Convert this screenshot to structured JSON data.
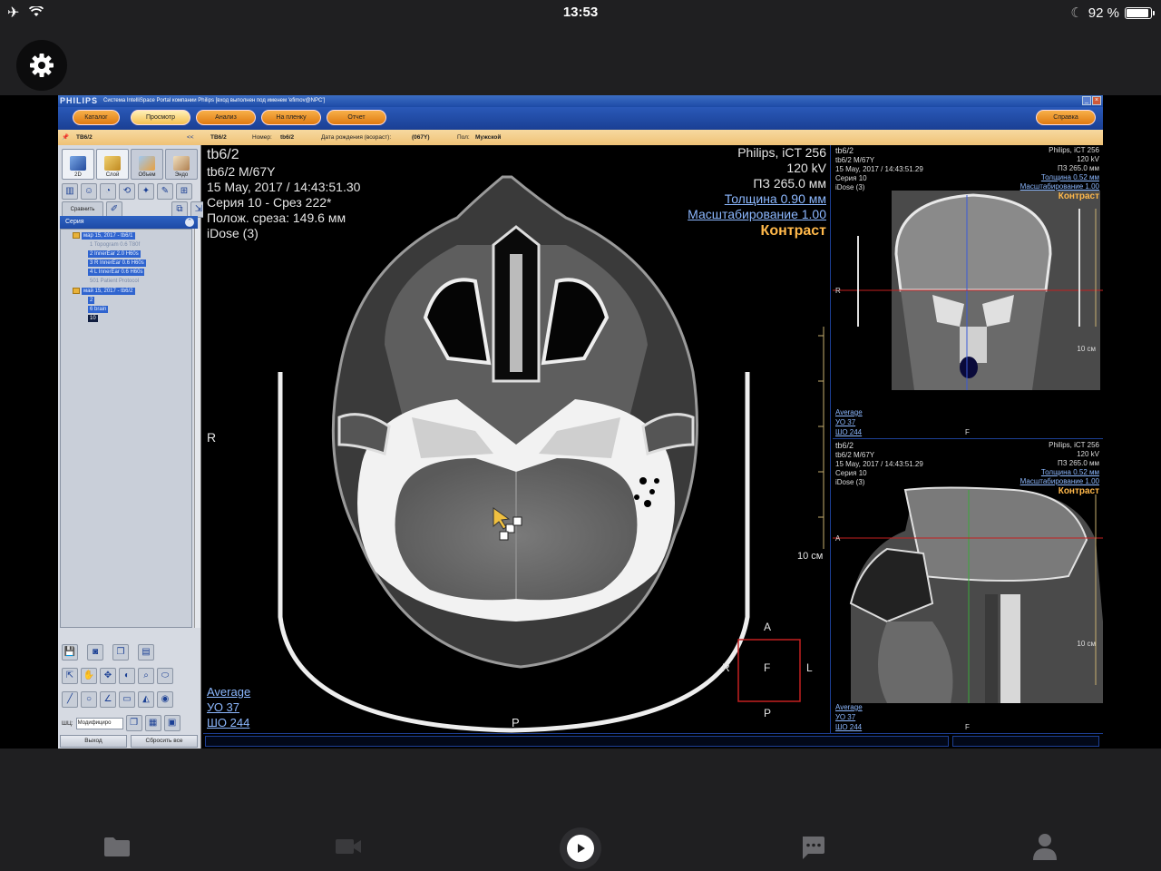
{
  "status_bar": {
    "time": "13:53",
    "battery": "92 %",
    "icons": [
      "airplane-icon",
      "wifi-icon",
      "moon-icon",
      "battery-icon"
    ]
  },
  "app": {
    "title_logo": "PHILIPS",
    "title_text": "Система IntelliSpace Portal компании Philips [вход выполнен под именем 'efimov@NPC']",
    "menu": [
      "Каталог",
      "Просмотр",
      "Анализ",
      "На пленку",
      "Отчет"
    ],
    "help_label": "Справка",
    "patient_bar": {
      "tab": "ТВ6/2",
      "name": "ТВ6/2",
      "number_label": "Номер:",
      "number": "tb6/2",
      "dob_label": "Дата рождения (возраст):",
      "dob": "(067Y)",
      "sex_label": "Пол:",
      "sex": "Мужской"
    }
  },
  "left_panel": {
    "view_modes": [
      {
        "label": "2D"
      },
      {
        "label": "Слой"
      },
      {
        "label": "Объем"
      },
      {
        "label": "Эндо"
      }
    ],
    "compare_label": "Сравнить",
    "collapse_label": "<<",
    "series_title": "Серия",
    "tree": [
      {
        "text": "мар 15, 2017 - tb6/1",
        "kind": "study"
      },
      {
        "text": "1  Topogram  0.6  T80f",
        "kind": "dim"
      },
      {
        "text": "2  InnerEar  2.0  H60s",
        "kind": "sel"
      },
      {
        "text": "3  R  InnerEar  0.6  H60s",
        "kind": "sel"
      },
      {
        "text": "4  L  InnerEar  0.6  H60s",
        "kind": "sel"
      },
      {
        "text": "501  Patient Protocol",
        "kind": "dim"
      },
      {
        "text": "май 15, 2017 - tb6/2",
        "kind": "study"
      },
      {
        "text": "2",
        "kind": "sel"
      },
      {
        "text": "6  brain",
        "kind": "sel"
      },
      {
        "text": "10",
        "kind": "dark"
      }
    ],
    "wl_label": "ШЦ:",
    "wl_value": "Модифициро",
    "exit_label": "Выход",
    "reset_label": "Сбросить все"
  },
  "main_view": {
    "top_left": [
      "tb6/2",
      "tb6/2 M/67Y",
      "15 May, 2017 / 14:43:51.30",
      "Серия 10 - Срез 222*",
      "Полож. среза: 149.6 мм",
      "iDose (3)"
    ],
    "top_right": [
      "Philips, iCT 256",
      "120 kV",
      "ПЗ 265.0 мм"
    ],
    "thickness": "Толщина 0.90 мм",
    "scaling": "Масштабирование 1.00",
    "contrast": "Контраст",
    "scale_label": "10 см",
    "orient_r": "R",
    "orient_p": "P",
    "bottom_left": [
      "Average",
      "УО    37",
      "ШО   244"
    ],
    "cube": {
      "a": "A",
      "r": "R",
      "f": "F",
      "l": "L",
      "p": "P"
    }
  },
  "side_top": {
    "top_left": [
      "tb6/2",
      "tb6/2 M/67Y",
      "15 May, 2017 / 14:43:51.29",
      "Серия 10",
      "iDose (3)"
    ],
    "top_right": [
      "Philips, iCT 256",
      "120 kV",
      "ПЗ 265.0 мм"
    ],
    "thickness": "Толщина 0.52 мм",
    "scaling": "Масштабирование 1.00",
    "contrast": "Контраст",
    "orient_r": "R",
    "orient_f": "F",
    "scale_label": "10 см",
    "bottom_left": [
      "Average",
      "УО    37",
      "ШО   244"
    ]
  },
  "side_bottom": {
    "top_left": [
      "tb6/2",
      "tb6/2 M/67Y",
      "15 May, 2017 / 14:43:51.29",
      "Серия 10",
      "iDose (3)"
    ],
    "top_right": [
      "Philips, iCT 256",
      "120 kV",
      "ПЗ 265.0 мм"
    ],
    "thickness": "Толщина 0.52 мм",
    "scaling": "Масштабирование 1.00",
    "contrast": "Контраст",
    "orient_a": "A",
    "orient_f": "F",
    "scale_label": "10 см",
    "bottom_left": [
      "Average",
      "УО    37",
      "ШО   244"
    ]
  },
  "bottom_tabs": [
    "folder-icon",
    "video-camera-icon",
    "play-icon",
    "chat-icon",
    "person-icon"
  ]
}
